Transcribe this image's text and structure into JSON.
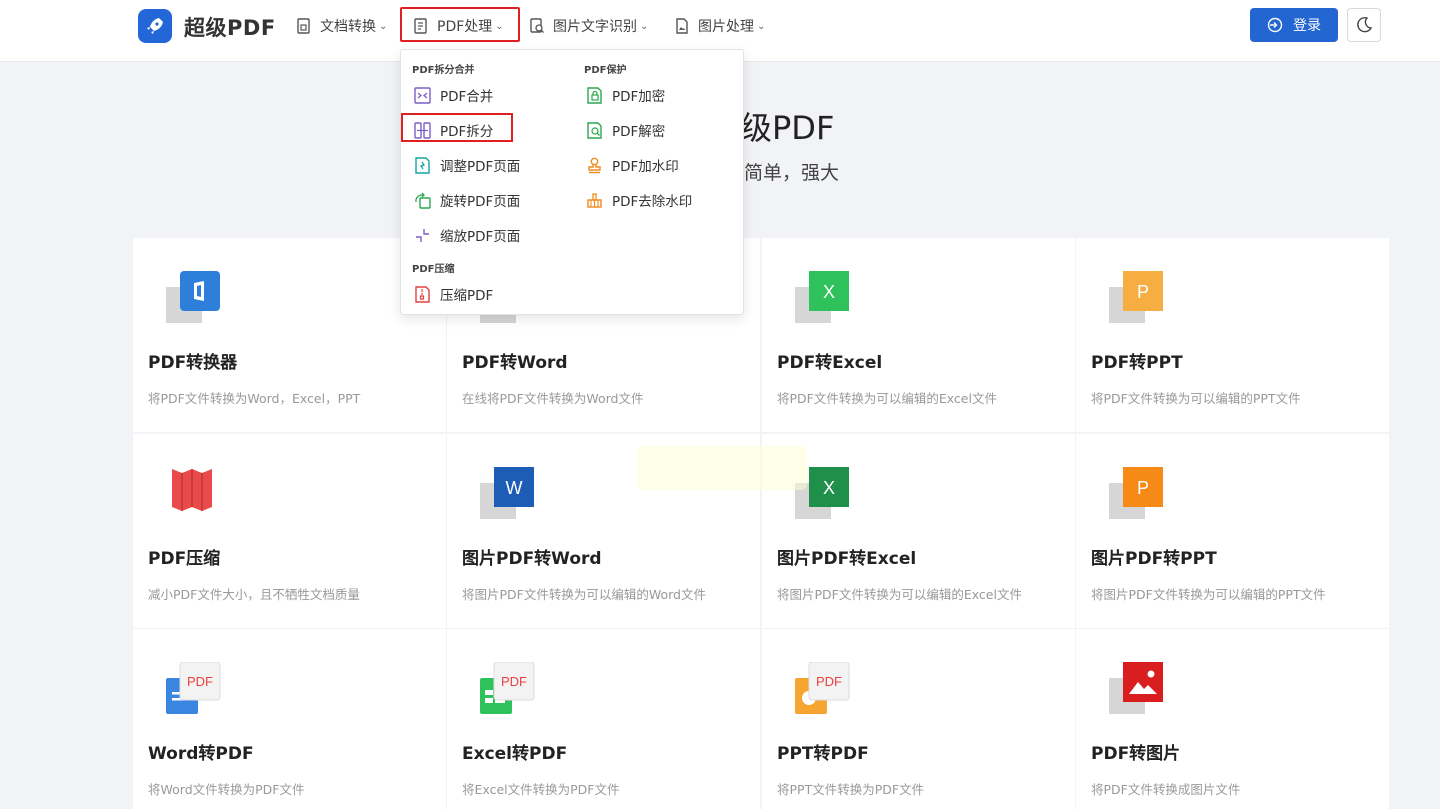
{
  "brand": {
    "name": "超级PDF",
    "accent": "#2266d8"
  },
  "nav": [
    {
      "label": "文档转换"
    },
    {
      "label": "PDF处理"
    },
    {
      "label": "图片文字识别"
    },
    {
      "label": "图片处理"
    }
  ],
  "header": {
    "login_label": "登录"
  },
  "hero": {
    "title": "级PDF",
    "subtitle": "简单，强大"
  },
  "dropdown": {
    "sections": {
      "split_merge": "PDF拆分合并",
      "protect": "PDF保护",
      "compress": "PDF压缩"
    },
    "left_items": [
      {
        "label": "PDF合并",
        "icon": "merge-icon"
      },
      {
        "label": "PDF拆分",
        "icon": "split-icon"
      },
      {
        "label": "调整PDF页面",
        "icon": "adjust-page-icon"
      },
      {
        "label": "旋转PDF页面",
        "icon": "rotate-icon"
      },
      {
        "label": "缩放PDF页面",
        "icon": "scale-icon"
      }
    ],
    "right_items": [
      {
        "label": "PDF加密",
        "icon": "lock-icon"
      },
      {
        "label": "PDF解密",
        "icon": "unlock-icon"
      },
      {
        "label": "PDF加水印",
        "icon": "stamp-icon"
      },
      {
        "label": "PDF去除水印",
        "icon": "eraser-icon"
      }
    ],
    "compress_item": {
      "label": "压缩PDF",
      "icon": "compress-icon"
    }
  },
  "cards": [
    {
      "title": "PDF转换器",
      "desc": "将PDF文件转换为Word，Excel，PPT",
      "icon": "office-icon",
      "color": "#2e7fd9",
      "badge": ""
    },
    {
      "title": "PDF转Word",
      "desc": "在线将PDF文件转换为Word文件",
      "icon": "word-icon",
      "color": "#2b5fb3",
      "badge": ""
    },
    {
      "title": "PDF转Excel",
      "desc": "将PDF文件转换为可以编辑的Excel文件",
      "icon": "excel-icon",
      "color": "#2fc15b",
      "badge": "X"
    },
    {
      "title": "PDF转PPT",
      "desc": "将PDF文件转换为可以编辑的PPT文件",
      "icon": "ppt-icon",
      "color": "#f6ad42",
      "badge": "P"
    },
    {
      "title": "PDF压缩",
      "desc": "减小PDF文件大小，且不牺牲文档质量",
      "icon": "compress-book-icon",
      "color": "#e94a4a",
      "badge": ""
    },
    {
      "title": "图片PDF转Word",
      "desc": "将图片PDF文件转换为可以编辑的Word文件",
      "icon": "word-icon",
      "color": "#1d5db5",
      "badge": "W"
    },
    {
      "title": "图片PDF转Excel",
      "desc": "将图片PDF文件转换为可以编辑的Excel文件",
      "icon": "excel-icon",
      "color": "#1f8f4a",
      "badge": "X"
    },
    {
      "title": "图片PDF转PPT",
      "desc": "将图片PDF文件转换为可以编辑的PPT文件",
      "icon": "ppt-icon",
      "color": "#f58a16",
      "badge": "P"
    },
    {
      "title": "Word转PDF",
      "desc": "将Word文件转换为PDF文件",
      "icon": "word-to-pdf-icon",
      "color": "#3a86e0",
      "badge": "PDF"
    },
    {
      "title": "Excel转PDF",
      "desc": "将Excel文件转换为PDF文件",
      "icon": "excel-to-pdf-icon",
      "color": "#2fc15b",
      "badge": "PDF"
    },
    {
      "title": "PPT转PDF",
      "desc": "将PPT文件转换为PDF文件",
      "icon": "ppt-to-pdf-icon",
      "color": "#f6a531",
      "badge": "PDF"
    },
    {
      "title": "PDF转图片",
      "desc": "将PDF文件转换成图片文件",
      "icon": "image-icon",
      "color": "#d81e1e",
      "badge": ""
    }
  ]
}
